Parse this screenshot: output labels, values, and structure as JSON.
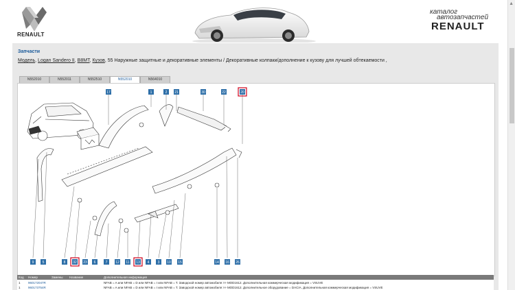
{
  "header": {
    "brand_under_logo": "RENAULT",
    "catalog_line1": "каталог",
    "catalog_line2": "автозапчастей",
    "catalog_brand": "RENAULT"
  },
  "section_title": "Запчасти",
  "breadcrumb": {
    "items": [
      "Модель",
      "Logan Sandero II",
      "B8MT",
      "Кузов"
    ],
    "separator": ",",
    "current": "55 Наружные защитные и декоративные элементы / Декоративные колпаки/дополнение к кузову для лучшей обтекаемости ,"
  },
  "tabs": [
    {
      "label": "N552010",
      "active": false
    },
    {
      "label": "N552011",
      "active": false
    },
    {
      "label": "N552510",
      "active": false
    },
    {
      "label": "N552010",
      "active": true
    },
    {
      "label": "N564010",
      "active": false
    }
  ],
  "diagram": {
    "top_callouts": [
      "17",
      "1",
      "2",
      "21",
      "30",
      "22",
      "20"
    ],
    "bottom_callouts": [
      "9",
      "5",
      "8",
      "32",
      "23",
      "6",
      "7",
      "12",
      "11",
      "13",
      "4",
      "3",
      "10",
      "15",
      "14",
      "16",
      "26"
    ],
    "highlighted": [
      "20",
      "32",
      "13"
    ],
    "highlight_color": "#d0021b",
    "callout_color": "#2e6fa8"
  },
  "table": {
    "headers": [
      "Код",
      "Номер",
      "Замены",
      "Название",
      "Дополнительная информация"
    ],
    "rows": [
      {
        "code": "1",
        "number": "960172047R",
        "info": "NFAB = A или NFAB = D или NFAB = I или NFAB = T. Заводской номер автомобиля >> MOD1612. Дополнительная коммерческая модификация = VSUVE"
      },
      {
        "code": "1",
        "number": "960173754R",
        "info": "NFAB = A или NFAB = D или NFAB = I или NFAB = T. Заводской номер автомобиля >> MOD1612. Дополнительное оборудование = DACIA. Дополнительная коммерческая модификация = VSUVE"
      }
    ]
  }
}
